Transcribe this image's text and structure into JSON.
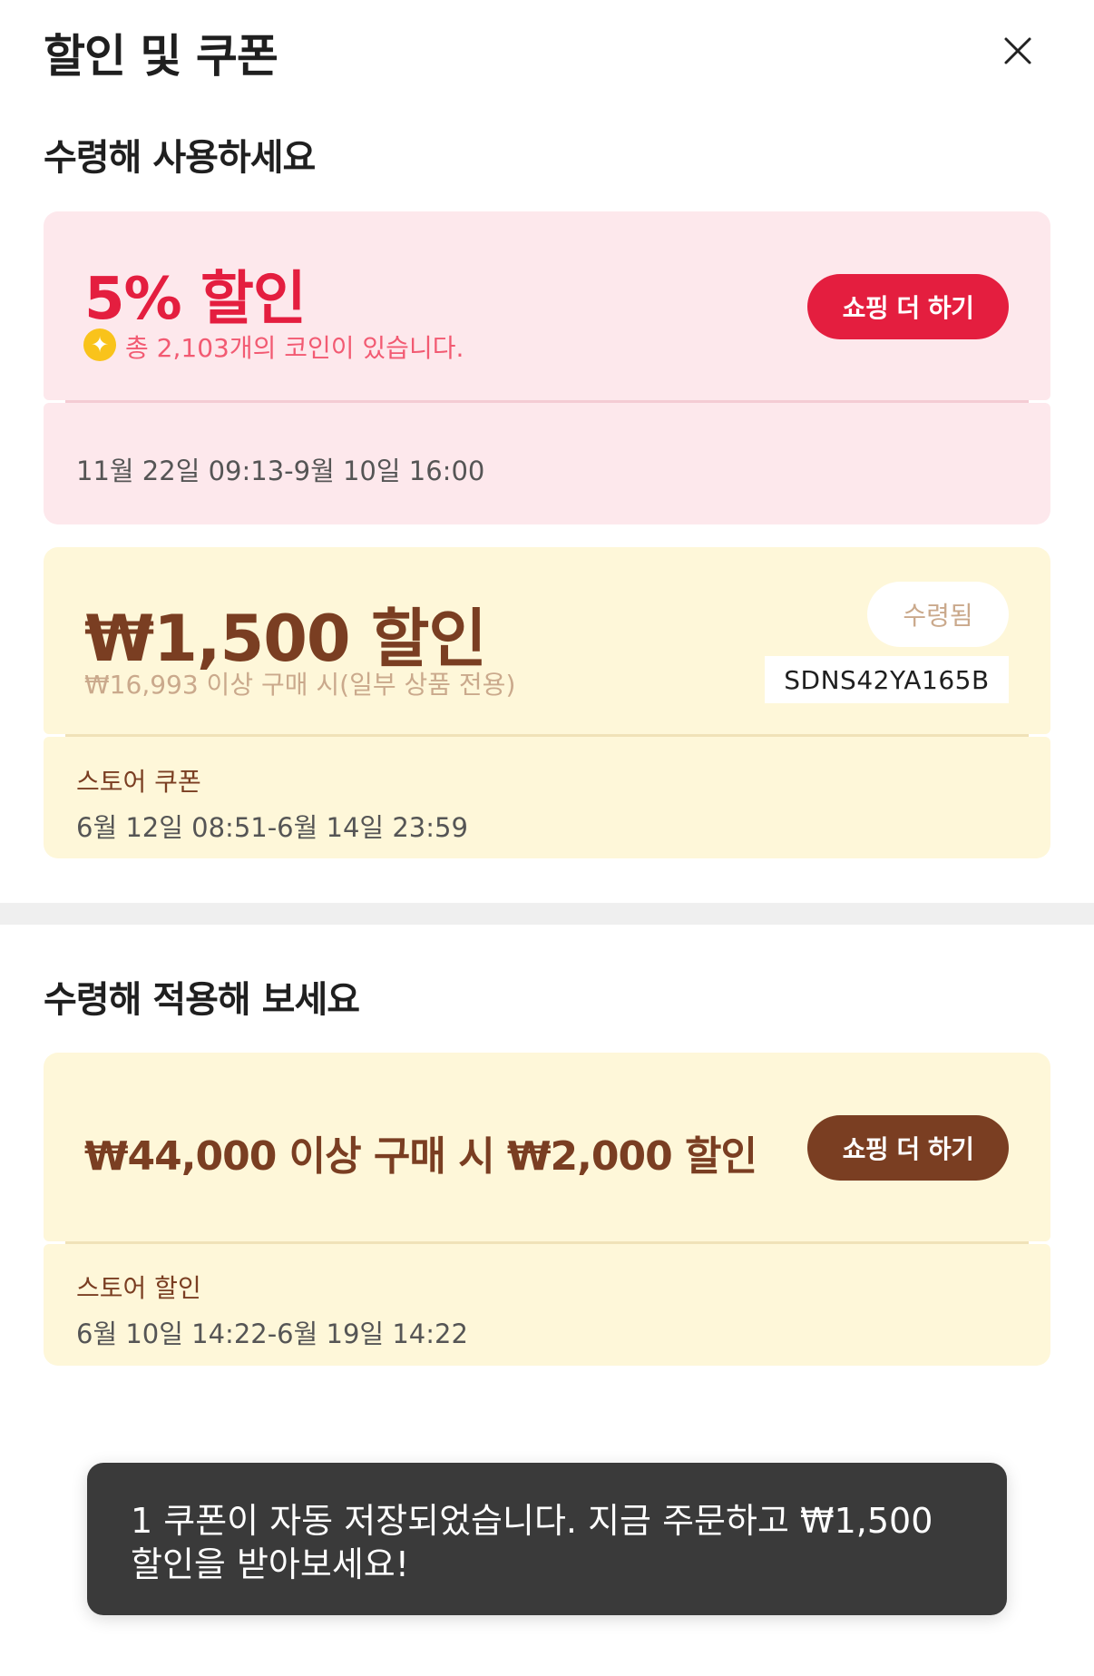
{
  "header": {
    "title": "할인 및 쿠폰",
    "close_icon": "close-icon"
  },
  "section1": {
    "title": "수령해 사용하세요",
    "coin_card": {
      "headline": "5% 할인",
      "coin_icon": "coin-icon",
      "subtext": "총 2,103개의 코인이 있습니다.",
      "button_label": "쇼핑 더 하기",
      "date_range": "11월 22일 09:13-9월 10일 16:00"
    },
    "coupon_card": {
      "headline": "₩1,500 할인",
      "subtext": "₩16,993 이상 구매 시(일부 상품 전용)",
      "status_label": "수령됨",
      "code": "SDNS42YA165B",
      "type_label": "스토어 쿠폰",
      "date_range": "6월 12일 08:51-6월 14일 23:59"
    }
  },
  "section2": {
    "title": "수령해 적용해 보세요",
    "discount_card": {
      "headline": "₩44,000 이상 구매 시 ₩2,000 할인",
      "button_label": "쇼핑 더 하기",
      "type_label": "스토어 할인",
      "date_range": "6월 10일 14:22-6월 19일 14:22"
    }
  },
  "toast": {
    "line1": "1 쿠폰이 자동 저장되었습니다. 지금 주문하고 ₩1,500",
    "line2": "할인을 받아보세요!"
  },
  "colors": {
    "accent_red": "#e41e3f",
    "accent_brown": "#7a3e22",
    "pink_card": "#fde8ec",
    "yellow_card": "#fef7d9",
    "coin_yellow": "#f9c31b"
  }
}
